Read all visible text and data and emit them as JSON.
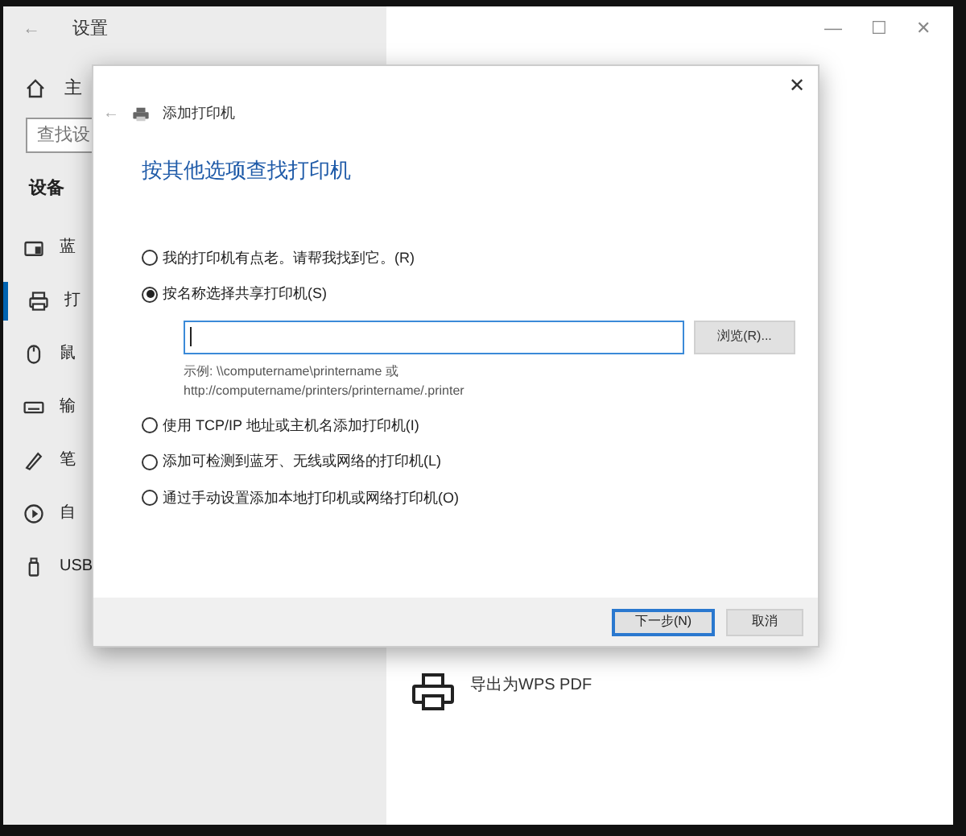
{
  "settings_window": {
    "back": "←",
    "title": "设置",
    "controls": [
      "—",
      "☐",
      "✕"
    ],
    "sidebar": {
      "home": "主",
      "search_placeholder": "查找设",
      "section": "设备",
      "items": [
        {
          "label": "蓝",
          "selected": false
        },
        {
          "label": "打",
          "selected": true
        },
        {
          "label": "鼠",
          "selected": false
        },
        {
          "label": "输",
          "selected": false
        },
        {
          "label": "笔",
          "selected": false
        },
        {
          "label": "自",
          "selected": false
        },
        {
          "label": "USB",
          "selected": false
        }
      ]
    },
    "printers": [
      {
        "name": "导出为WPS PDF"
      }
    ]
  },
  "dialog": {
    "close": "✕",
    "back": "←",
    "title": "添加打印机",
    "heading": "按其他选项查找打印机",
    "options": [
      {
        "label": "我的打印机有点老。请帮我找到它。(R)",
        "selected": false
      },
      {
        "label": "按名称选择共享打印机(S)",
        "selected": true,
        "field": {
          "placeholder_cursor": true
        },
        "browse": "浏览(R)...",
        "example": [
          "示例: \\\\computername\\printername 或",
          "http://computername/printers/printername/.printer"
        ]
      },
      {
        "label": "使用 TCP/IP 地址或主机名添加打印机(I)",
        "selected": false
      },
      {
        "label": "添加可检测到蓝牙、无线或网络的打印机(L)",
        "selected": false
      },
      {
        "label": "通过手动设置添加本地打印机或网络打印机(O)",
        "selected": false
      }
    ],
    "buttons": [
      {
        "label": "下一步(N)",
        "default": true
      },
      {
        "label": "取消",
        "default": false
      }
    ]
  }
}
